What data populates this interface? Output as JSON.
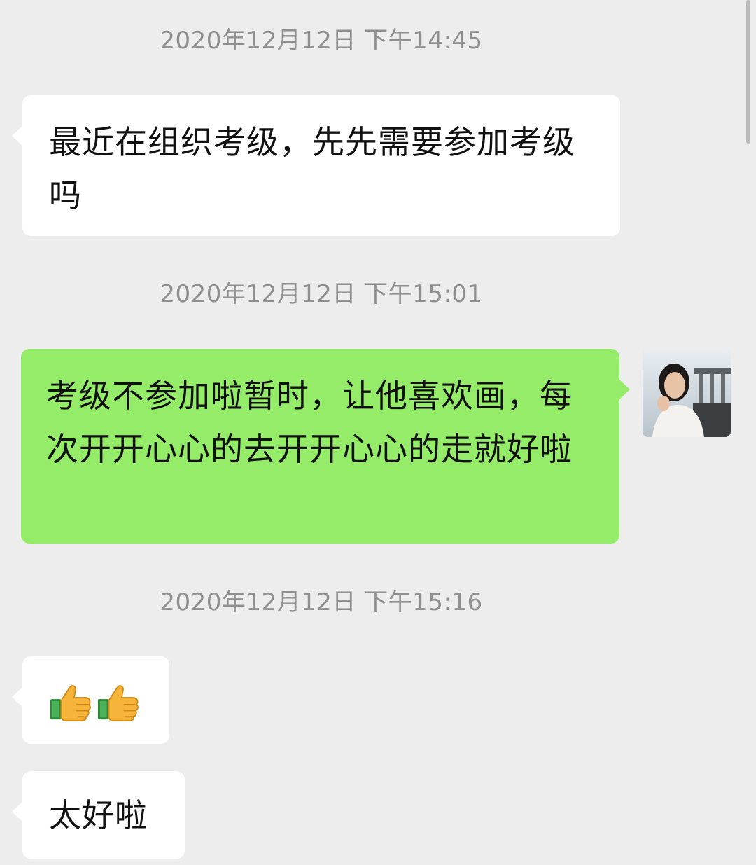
{
  "chat": {
    "messages": [
      {
        "type": "timestamp",
        "text": "2020年12月12日 下午14:45"
      },
      {
        "type": "incoming",
        "text": "最近在组织考级，先先需要参加考级吗"
      },
      {
        "type": "timestamp",
        "text": "2020年12月12日 下午15:01"
      },
      {
        "type": "outgoing",
        "text": "考级不参加啦暂时，让他喜欢画，每次开开心心的去开开心心的走就好啦",
        "avatar": "user-avatar-photo"
      },
      {
        "type": "timestamp",
        "text": "2020年12月12日 下午15:16"
      },
      {
        "type": "incoming",
        "emoji": [
          "thumbs-up-emoji",
          "thumbs-up-emoji"
        ]
      },
      {
        "type": "incoming",
        "text": "太好啦"
      }
    ]
  },
  "colors": {
    "background": "#ededed",
    "incoming_bubble": "#ffffff",
    "outgoing_bubble": "#95ec69",
    "timestamp_text": "#8f8f8f"
  }
}
